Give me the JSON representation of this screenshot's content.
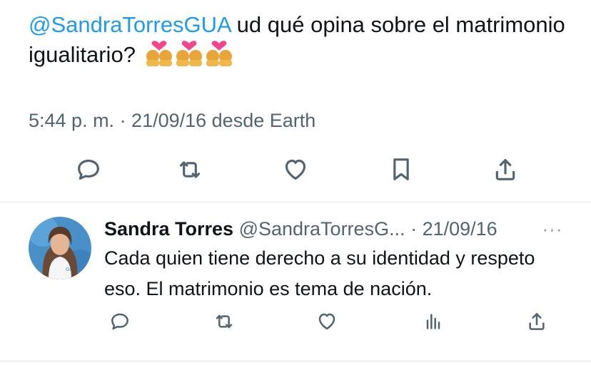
{
  "main_tweet": {
    "mention": "@SandraTorresGUA",
    "text_after_mention": " ud qué opina sobre el matrimonio igualitario?",
    "emojis": [
      "couple-with-heart-woman-woman",
      "couple-with-heart-woman-woman",
      "couple-with-heart-woman-woman"
    ],
    "meta": "5:44 p. m. · 21/09/16 desde Earth",
    "actions": [
      "reply-icon",
      "retweet-icon",
      "like-icon",
      "bookmark-icon",
      "share-icon"
    ]
  },
  "reply": {
    "name": "Sandra Torres",
    "handle_date": " @SandraTorresG... · 21/09/16",
    "more": "···",
    "text": "Cada quien tiene derecho a su identidad y respeto eso. El matrimonio es tema de nación.",
    "actions": [
      "reply-icon",
      "retweet-icon",
      "like-icon",
      "views-icon",
      "share-icon"
    ]
  },
  "colors": {
    "accent": "#1d9bf0",
    "text": "#0f1419",
    "secondary": "#536471",
    "divider": "#e6e9ec"
  }
}
